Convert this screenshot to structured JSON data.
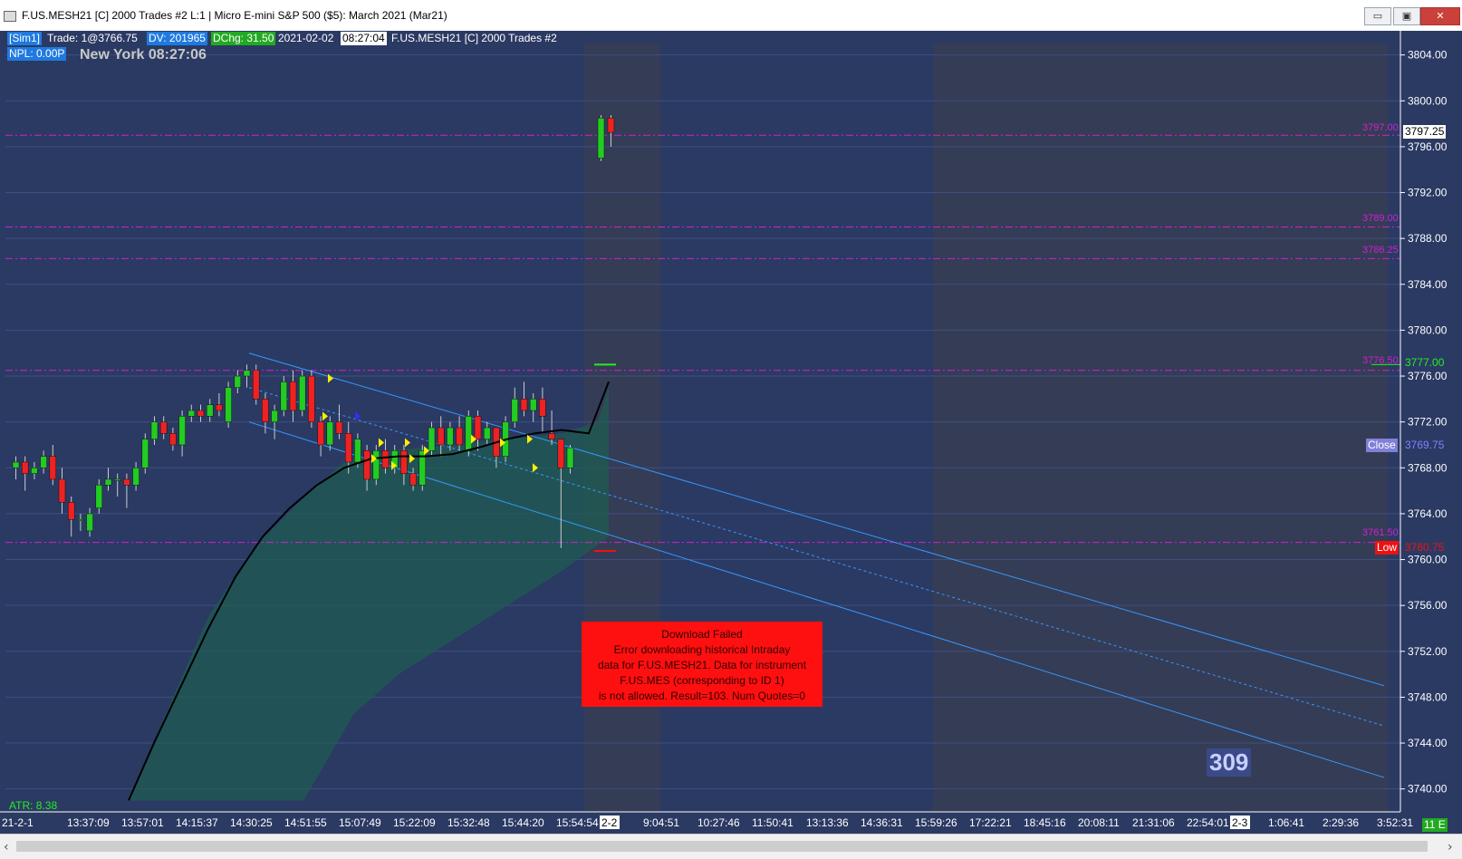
{
  "window": {
    "title": "F.US.MESH21 [C]  2000 Trades  #2 L:1 | Micro E-mini S&P 500 ($5): March 2021 (Mar21)",
    "minimize": "▭",
    "maximize": "▣",
    "close": "✕"
  },
  "header": {
    "sim": "[Sim1]",
    "trade": "Trade: 1@3766.75",
    "dv": "DV: 201965",
    "dchg": "DChg: 31.50",
    "date": "2021-02-02",
    "time": "08:27:04",
    "symbol": "F.US.MESH21 [C]  2000 Trades  #2",
    "npl": "NPL: 0.00P",
    "clock": "New York 08:27:06"
  },
  "atr": "ATR: 8.38",
  "big_number": "309",
  "error_box": {
    "lines": [
      "Download Failed",
      "Error downloading historical Intraday",
      "data for F.US.MESH21.  Data for instrument",
      "F.US.MES (corresponding to ID 1)",
      "is not allowed. Result=103. Num Quotes=0"
    ]
  },
  "price_tags": {
    "last": "3797.25",
    "level_3797": "3797.00",
    "level_3789": "3789.00",
    "level_3786": "3786.25",
    "level_3776": "3776.50",
    "green_tag": "3777.00",
    "close_label": "Close",
    "close_value": "3769.75",
    "level_3761": "3761.50",
    "low_label": "Low",
    "low_value": "3760.75"
  },
  "bottom_right_tag": "11 E",
  "colors": {
    "background": "#2b3a63",
    "up": "#22cc22",
    "down": "#ee2222",
    "level": "#d020d0",
    "channel": "#3399ff",
    "band": "#1f5c52"
  },
  "chart_data": {
    "type": "candlestick",
    "y_axis": {
      "range": [
        3738,
        3805
      ],
      "ticks": [
        "3804.00",
        "3800.00",
        "3796.00",
        "3792.00",
        "3788.00",
        "3784.00",
        "3780.00",
        "3776.00",
        "3772.00",
        "3768.00",
        "3764.00",
        "3760.00",
        "3756.00",
        "3752.00",
        "3748.00",
        "3744.00",
        "3740.00"
      ]
    },
    "x_axis": {
      "ticks": [
        "21-2-1",
        "13:37:09",
        "13:57:01",
        "14:15:37",
        "14:30:25",
        "14:51:55",
        "15:07:49",
        "15:22:09",
        "15:32:48",
        "15:44:20",
        "15:54:54",
        "2-2",
        "9:04:51",
        "10:27:46",
        "11:50:41",
        "13:13:36",
        "14:36:31",
        "15:59:26",
        "17:22:21",
        "18:45:16",
        "20:08:11",
        "21:31:06",
        "22:54:01",
        "2-3",
        "1:06:41",
        "2:29:36",
        "3:52:31"
      ]
    },
    "horizontal_levels": [
      3797.0,
      3789.0,
      3786.25,
      3776.5,
      3761.5
    ],
    "candles": [
      [
        3768.0,
        3769.0,
        3767.0,
        3768.5
      ],
      [
        3768.5,
        3769.0,
        3766.0,
        3767.5
      ],
      [
        3767.5,
        3768.5,
        3767.0,
        3768.0
      ],
      [
        3768.0,
        3769.5,
        3767.5,
        3769.0
      ],
      [
        3769.0,
        3770.0,
        3766.5,
        3767.0
      ],
      [
        3767.0,
        3768.0,
        3764.0,
        3765.0
      ],
      [
        3765.0,
        3765.5,
        3762.0,
        3763.5
      ],
      [
        3763.5,
        3764.0,
        3762.5,
        3763.5
      ],
      [
        3762.5,
        3764.5,
        3762.0,
        3764.0
      ],
      [
        3764.5,
        3767.0,
        3764.0,
        3766.5
      ],
      [
        3766.5,
        3768.0,
        3766.0,
        3767.0
      ],
      [
        3767.0,
        3767.5,
        3765.5,
        3767.0
      ],
      [
        3767.0,
        3767.5,
        3764.5,
        3766.5
      ],
      [
        3766.5,
        3768.5,
        3766.0,
        3768.0
      ],
      [
        3768.0,
        3771.0,
        3767.5,
        3770.5
      ],
      [
        3770.5,
        3772.5,
        3770.0,
        3772.0
      ],
      [
        3772.0,
        3772.5,
        3770.5,
        3771.0
      ],
      [
        3771.0,
        3771.5,
        3769.5,
        3770.0
      ],
      [
        3770.0,
        3773.0,
        3769.0,
        3772.5
      ],
      [
        3772.5,
        3773.5,
        3772.0,
        3773.0
      ],
      [
        3773.0,
        3773.5,
        3772.0,
        3772.5
      ],
      [
        3772.5,
        3774.0,
        3772.0,
        3773.5
      ],
      [
        3773.5,
        3774.5,
        3772.5,
        3773.0
      ],
      [
        3772.0,
        3775.5,
        3771.5,
        3775.0
      ],
      [
        3775.0,
        3776.5,
        3774.5,
        3776.0
      ],
      [
        3776.0,
        3777.0,
        3775.0,
        3776.5
      ],
      [
        3776.5,
        3777.0,
        3773.5,
        3774.0
      ],
      [
        3774.0,
        3774.5,
        3771.0,
        3772.0
      ],
      [
        3772.0,
        3773.5,
        3770.5,
        3773.0
      ],
      [
        3773.0,
        3776.0,
        3772.5,
        3775.5
      ],
      [
        3775.5,
        3776.5,
        3772.0,
        3773.0
      ],
      [
        3773.0,
        3776.5,
        3772.5,
        3776.0
      ],
      [
        3776.0,
        3776.5,
        3771.5,
        3772.0
      ],
      [
        3772.0,
        3772.5,
        3769.0,
        3770.0
      ],
      [
        3770.0,
        3772.5,
        3769.5,
        3772.0
      ],
      [
        3772.0,
        3773.5,
        3770.5,
        3771.0
      ],
      [
        3771.0,
        3772.0,
        3767.5,
        3768.5
      ],
      [
        3768.5,
        3771.0,
        3768.0,
        3770.5
      ],
      [
        3769.5,
        3770.0,
        3766.0,
        3767.0
      ],
      [
        3767.0,
        3770.0,
        3766.5,
        3769.5
      ],
      [
        3769.5,
        3770.5,
        3767.5,
        3768.0
      ],
      [
        3768.0,
        3770.0,
        3767.5,
        3769.5
      ],
      [
        3769.5,
        3770.0,
        3766.5,
        3767.5
      ],
      [
        3767.5,
        3768.0,
        3766.0,
        3766.5
      ],
      [
        3766.5,
        3770.0,
        3766.0,
        3769.5
      ],
      [
        3769.5,
        3772.0,
        3769.0,
        3771.5
      ],
      [
        3771.5,
        3772.5,
        3769.0,
        3770.0
      ],
      [
        3770.0,
        3772.0,
        3769.5,
        3771.5
      ],
      [
        3771.5,
        3772.5,
        3769.5,
        3770.0
      ],
      [
        3769.5,
        3773.0,
        3769.0,
        3772.5
      ],
      [
        3772.5,
        3773.0,
        3769.5,
        3770.5
      ],
      [
        3770.5,
        3772.0,
        3770.0,
        3771.5
      ],
      [
        3771.5,
        3771.5,
        3768.0,
        3769.0
      ],
      [
        3769.0,
        3772.5,
        3768.5,
        3772.0
      ],
      [
        3772.0,
        3775.0,
        3771.5,
        3774.0
      ],
      [
        3774.0,
        3775.5,
        3772.5,
        3773.0
      ],
      [
        3773.0,
        3774.5,
        3772.0,
        3774.0
      ],
      [
        3774.0,
        3775.0,
        3771.0,
        3772.5
      ],
      [
        3771.0,
        3773.0,
        3770.0,
        3770.5
      ],
      [
        3770.5,
        3770.5,
        3761.0,
        3768.0
      ],
      [
        3768.0,
        3770.0,
        3767.5,
        3769.75
      ]
    ],
    "gap_candles": [
      [
        3795.0,
        3798.75,
        3794.75,
        3798.5
      ],
      [
        3798.5,
        3798.75,
        3796.0,
        3797.25
      ]
    ],
    "moving_average": [
      3769.5,
      3770.0,
      3770.5,
      3770.8,
      3771.0,
      3771.2,
      3771.5,
      3772.0,
      3772.5,
      3773.0,
      3773.5,
      3774.0,
      3774.5,
      3776.0
    ],
    "channel": {
      "upper": [
        [
          3778.0,
          3749.0
        ]
      ],
      "middle": [
        [
          3775.0,
          3745.5
        ]
      ],
      "lower": [
        [
          3772.0,
          3741.0
        ]
      ]
    }
  }
}
